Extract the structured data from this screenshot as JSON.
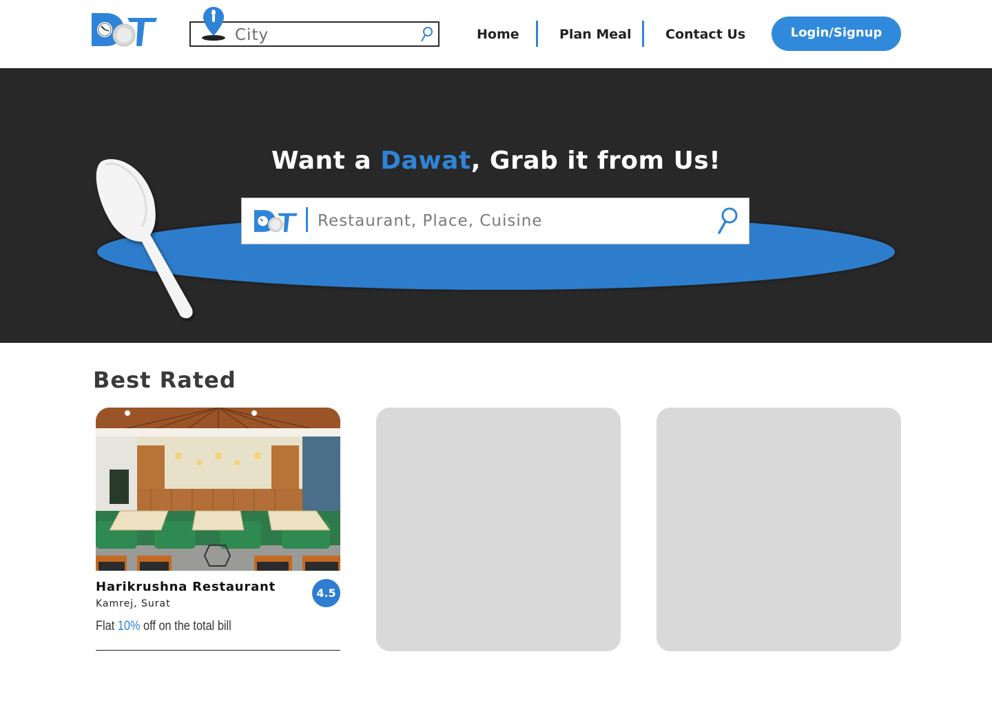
{
  "header": {
    "logo_icon": "dot-logo",
    "city_search": {
      "placeholder": "City",
      "pin_icon": "location-pin-icon",
      "search_icon": "search-icon"
    },
    "nav": [
      {
        "label": "Home"
      },
      {
        "label": "Plan Meal"
      },
      {
        "label": "Contact Us"
      }
    ],
    "login_label": "Login/Signup"
  },
  "hero": {
    "title_prefix": "Want a ",
    "title_accent": "Dawat",
    "title_suffix": ", Grab it from Us!",
    "search": {
      "placeholder": "Restaurant, Place, Cuisine",
      "search_icon": "search-icon"
    }
  },
  "best_rated": {
    "title": "Best Rated",
    "cards": [
      {
        "name": "Harikrushna Restaurant",
        "location": "Kamrej, Surat",
        "rating": "4.5",
        "offer_prefix": "Flat ",
        "offer_value": "10%",
        "offer_suffix": " off on the total bill"
      }
    ]
  },
  "colors": {
    "accent": "#2f84d8",
    "hero_bg": "#282828",
    "plate": "#2d7dcc",
    "placeholder_card": "#d9d9d9"
  }
}
